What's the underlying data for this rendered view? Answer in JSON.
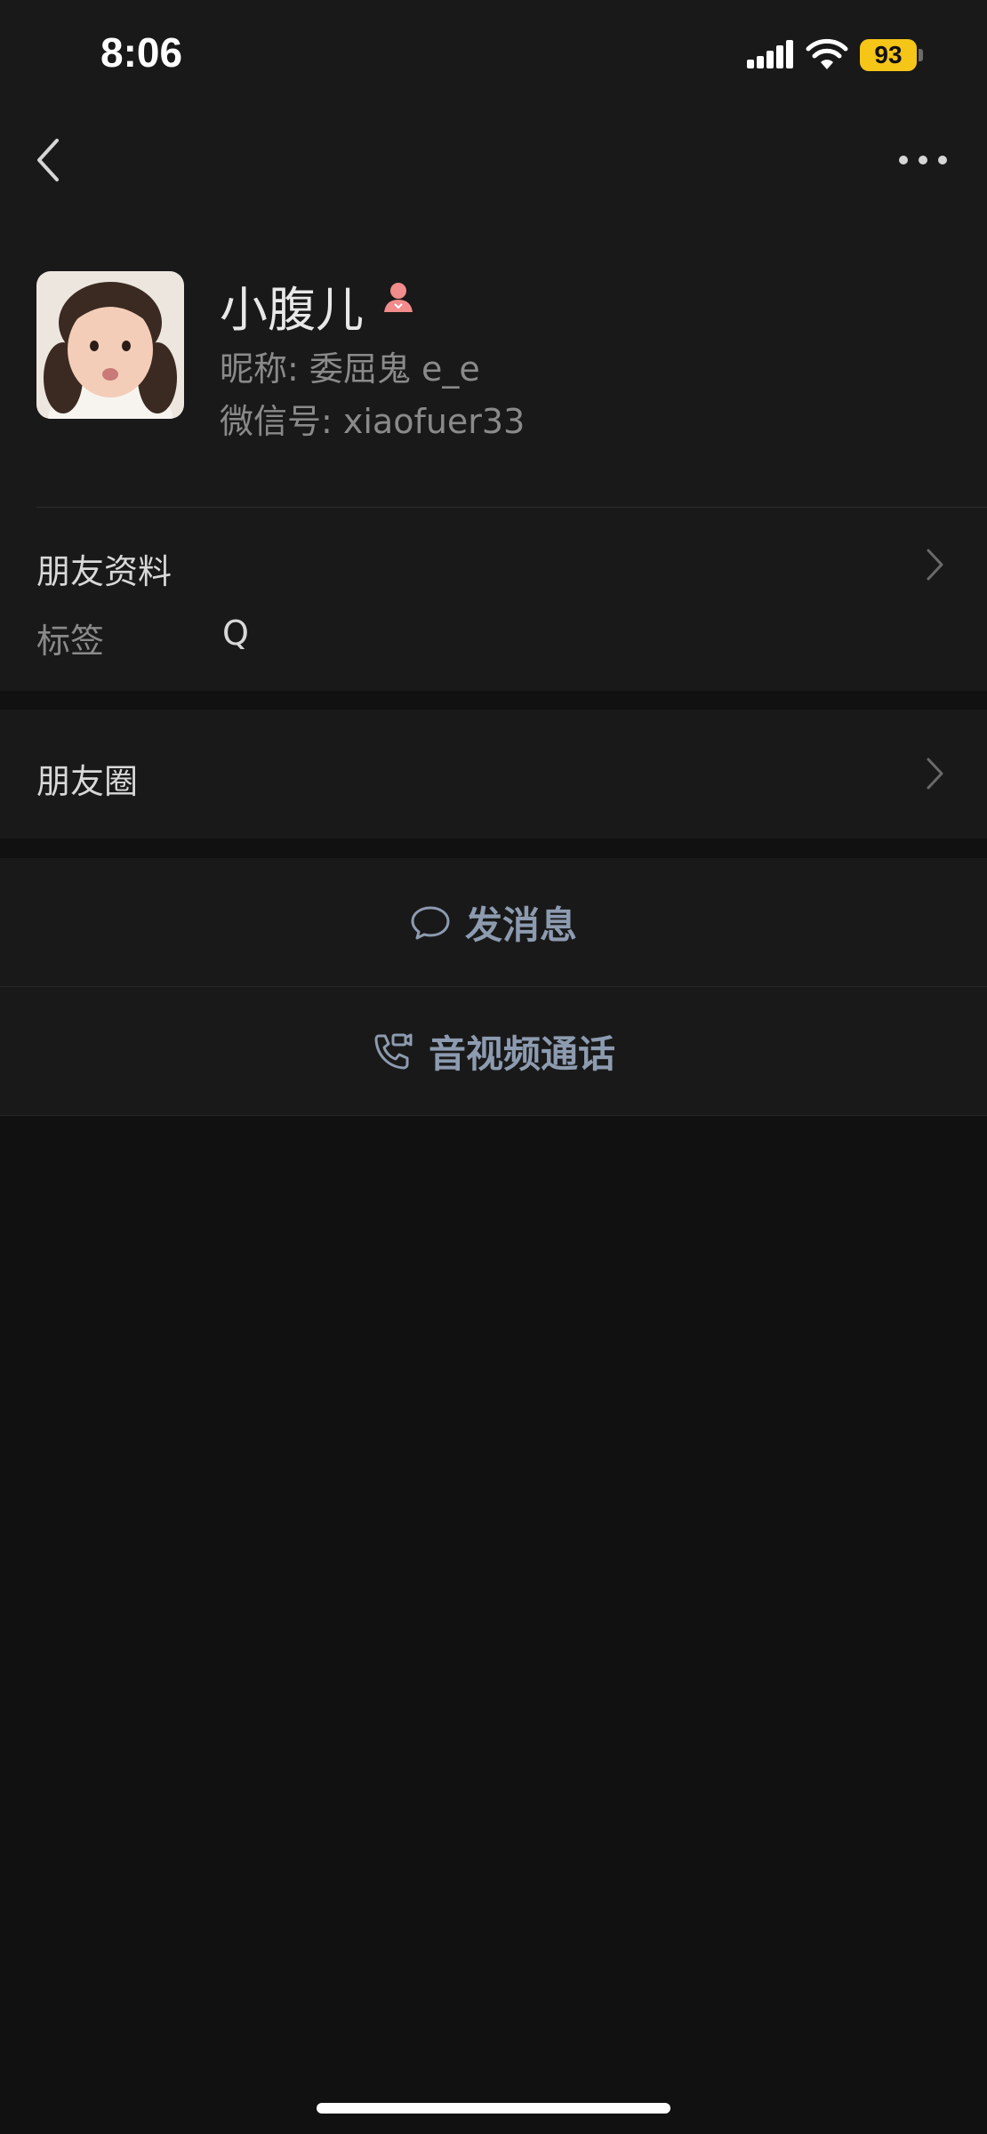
{
  "status_bar": {
    "time": "8:06",
    "battery": "93",
    "battery_color": "#f5c518"
  },
  "nav": {
    "back_icon": "chevron-left-icon",
    "more_icon": "ellipsis-icon"
  },
  "profile": {
    "name": "小腹儿",
    "gender_icon": "female-icon",
    "nickname": "昵称: 委屈鬼 e_e",
    "wechat_id": "微信号: xiaofuer33"
  },
  "friend_info": {
    "title": "朋友资料",
    "tag_label": "标签",
    "tag_value": "Q"
  },
  "moments": {
    "title": "朋友圈"
  },
  "actions": {
    "message_label": "发消息",
    "call_label": "音视频通话",
    "accent": "#8d9bb0"
  }
}
